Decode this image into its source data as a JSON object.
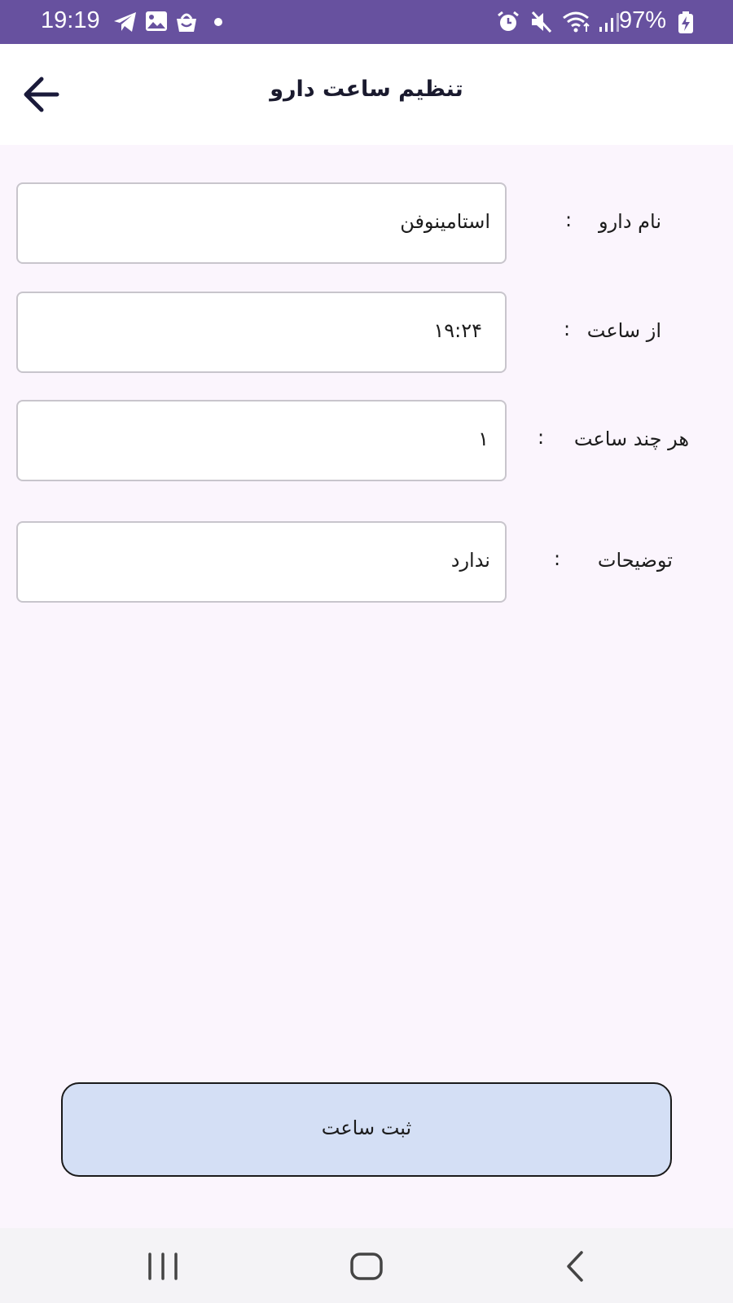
{
  "status_bar": {
    "time": "19:19",
    "battery_percent": "97%",
    "left_icons": [
      "telegram-icon",
      "gallery-icon",
      "shop-bag-icon",
      "dot-icon"
    ],
    "right_icons": [
      "alarm-icon",
      "mute-icon",
      "wifi-icon",
      "signal-icon",
      "battery-charging-icon"
    ],
    "background": "#67519f"
  },
  "app_bar": {
    "title": "تنظیم ساعت دارو",
    "back_icon": "arrow-left-icon"
  },
  "form": {
    "fields": [
      {
        "label": "نام دارو",
        "colon": ":",
        "value": "استامینوفن"
      },
      {
        "label": "از ساعت",
        "colon": ":",
        "value": "۱۹:۲۴"
      },
      {
        "label": "هر چند ساعت",
        "colon": ":",
        "value": "۱"
      },
      {
        "label": "توضیحات",
        "colon": ":",
        "value": "ندارد"
      }
    ]
  },
  "submit": {
    "label": "ثبت ساعت",
    "background": "#d4dff5"
  },
  "nav_bar": {
    "buttons": [
      "recent-apps-icon",
      "home-icon",
      "back-icon"
    ]
  }
}
